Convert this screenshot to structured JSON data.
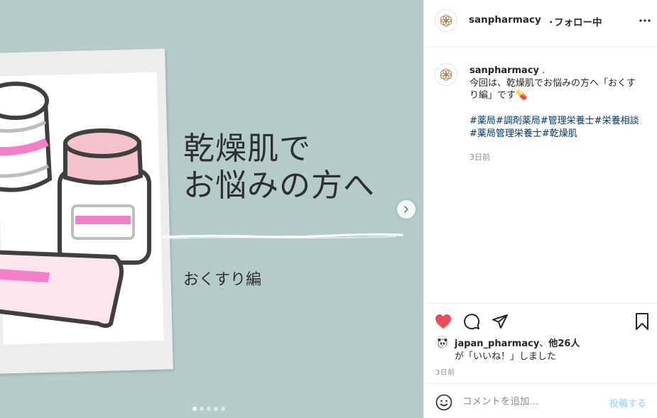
{
  "post": {
    "headline": "乾燥肌で\nお悩みの方へ",
    "subtitle": "おくすり編",
    "carousel_count": 5,
    "carousel_active": 1
  },
  "header": {
    "username": "sanpharmacy",
    "separator": "・",
    "follow_status": "フォロー中"
  },
  "caption": {
    "username": "sanpharmacy",
    "suffix": " .",
    "text": "今回は、乾燥肌でお悩みの方へ「おくすり編」です💊",
    "hashtags": "#薬局#調剤薬局#管理栄養士#栄養相談#薬局管理栄養士#乾燥肌",
    "time": "3日前"
  },
  "likes": {
    "liker": "japan_pharmacy",
    "mid": "、",
    "others": "他26人",
    "line2": "が「いいね！」しました"
  },
  "post_time": "3日前",
  "comment": {
    "placeholder": "コメントを追加...",
    "post_label": "投稿する"
  },
  "colors": {
    "image_bg": "#b6cccb",
    "heart": "#ed4956",
    "hashtag": "#00376b",
    "post_button": "#b3dbff",
    "pink": "#f57ec9"
  }
}
